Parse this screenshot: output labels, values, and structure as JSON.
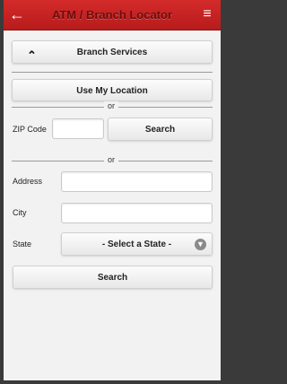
{
  "header": {
    "title": "ATM / Branch Locator",
    "back_icon": "←",
    "menu_icon": "≡"
  },
  "branch_services": {
    "label": "Branch Services",
    "icon": "⌃"
  },
  "location": {
    "use_my_location_label": "Use My Location",
    "or_label_1": "or",
    "zip_label": "ZIP Code",
    "zip_value": "",
    "zip_search_label": "Search",
    "or_label_2": "or"
  },
  "address_form": {
    "address_label": "Address",
    "address_value": "",
    "city_label": "City",
    "city_value": "",
    "state_label": "State",
    "state_selected": "- Select a State -",
    "search_label": "Search"
  }
}
